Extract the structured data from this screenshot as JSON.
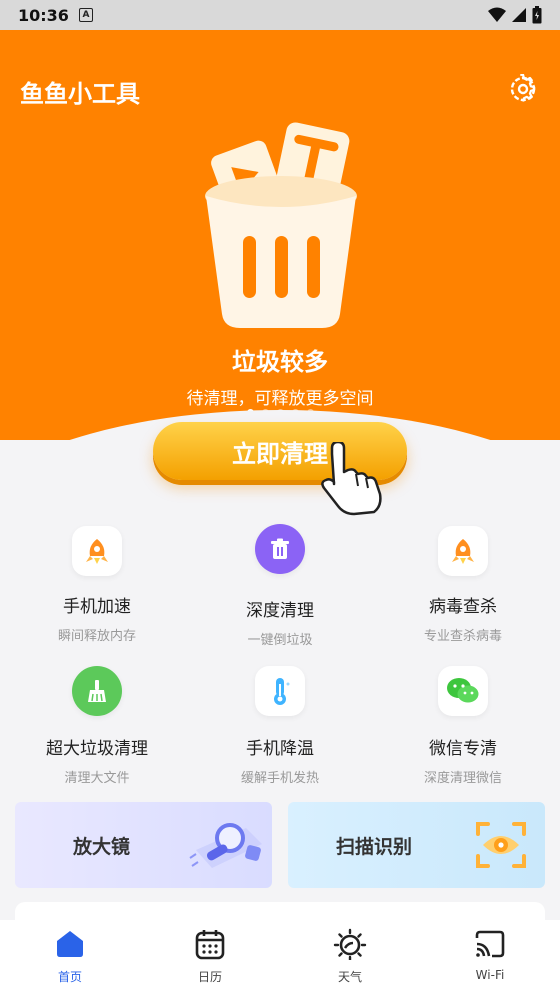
{
  "status_bar": {
    "time": "10:36",
    "notification": "A"
  },
  "header": {
    "title": "鱼鱼小工具"
  },
  "hero": {
    "title": "垃圾较多",
    "subtitle": "待清理，可释放更多空间",
    "page_count": 5,
    "active_page": 0
  },
  "clean_button": {
    "label": "立即清理"
  },
  "tools": [
    {
      "name": "手机加速",
      "desc": "瞬间释放内存",
      "icon": "rocket-icon"
    },
    {
      "name": "深度清理",
      "desc": "一键倒垃圾",
      "icon": "trash-icon"
    },
    {
      "name": "病毒查杀",
      "desc": "专业查杀病毒",
      "icon": "rocket-icon"
    },
    {
      "name": "超大垃圾清理",
      "desc": "清理大文件",
      "icon": "broom-icon"
    },
    {
      "name": "手机降温",
      "desc": "缓解手机发热",
      "icon": "thermometer-icon"
    },
    {
      "name": "微信专清",
      "desc": "深度清理微信",
      "icon": "wechat-icon"
    }
  ],
  "cards": {
    "magnifier_label": "放大镜",
    "scan_label": "扫描识别"
  },
  "tabs": [
    {
      "label": "首页",
      "icon": "home-icon",
      "active": true
    },
    {
      "label": "日历",
      "icon": "calendar-icon",
      "active": false
    },
    {
      "label": "天气",
      "icon": "weather-icon",
      "active": false
    },
    {
      "label": "Wi-Fi",
      "icon": "cast-icon",
      "active": false
    }
  ],
  "colors": {
    "brand_orange": "#ff8200",
    "button_yellow": "#f4a000",
    "tab_active": "#2a63e8"
  }
}
